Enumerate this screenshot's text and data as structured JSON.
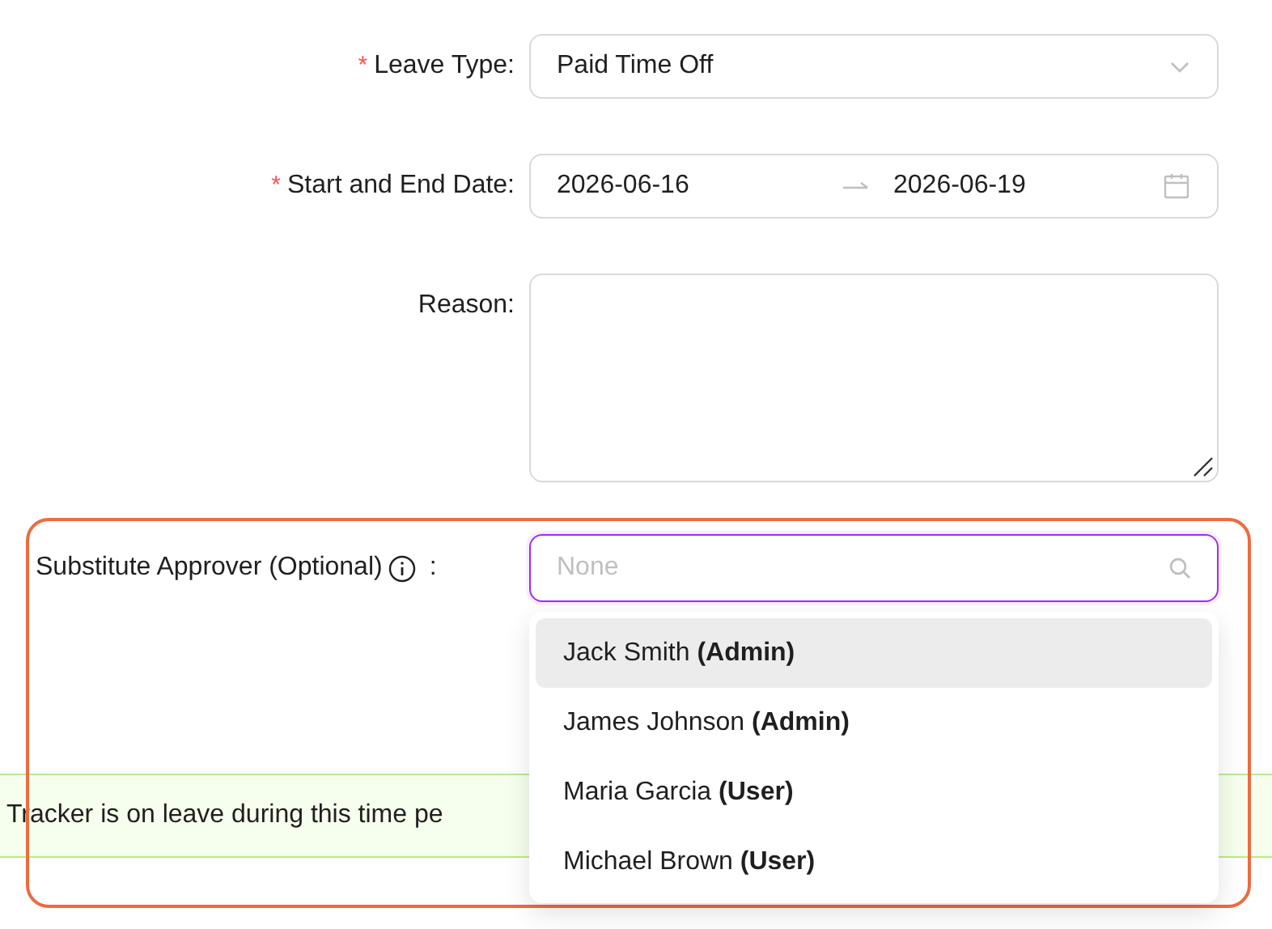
{
  "form": {
    "fields": [
      {
        "kind": "select",
        "required_mark": "*",
        "label": "Leave Type:",
        "value": "Paid Time Off"
      },
      {
        "kind": "daterange",
        "required_mark": "*",
        "label": "Start and End Date:",
        "start": "2026-06-16",
        "end": "2026-06-19"
      },
      {
        "kind": "textarea",
        "label": "Reason:"
      }
    ]
  },
  "approver": {
    "label": "Substitute Approver (Optional)",
    "label_suffix": ":",
    "placeholder": "None",
    "options": [
      {
        "text": "Jack Smith **(Admin)**",
        "selected": true
      },
      {
        "text": "James Johnson **(Admin)**",
        "selected": false
      },
      {
        "text": "Maria Garcia **(User)**",
        "selected": false
      },
      {
        "text": "Michael Brown **(User)**",
        "selected": false
      }
    ]
  },
  "banner": {
    "text": "Tracker is on leave during this time pe"
  }
}
